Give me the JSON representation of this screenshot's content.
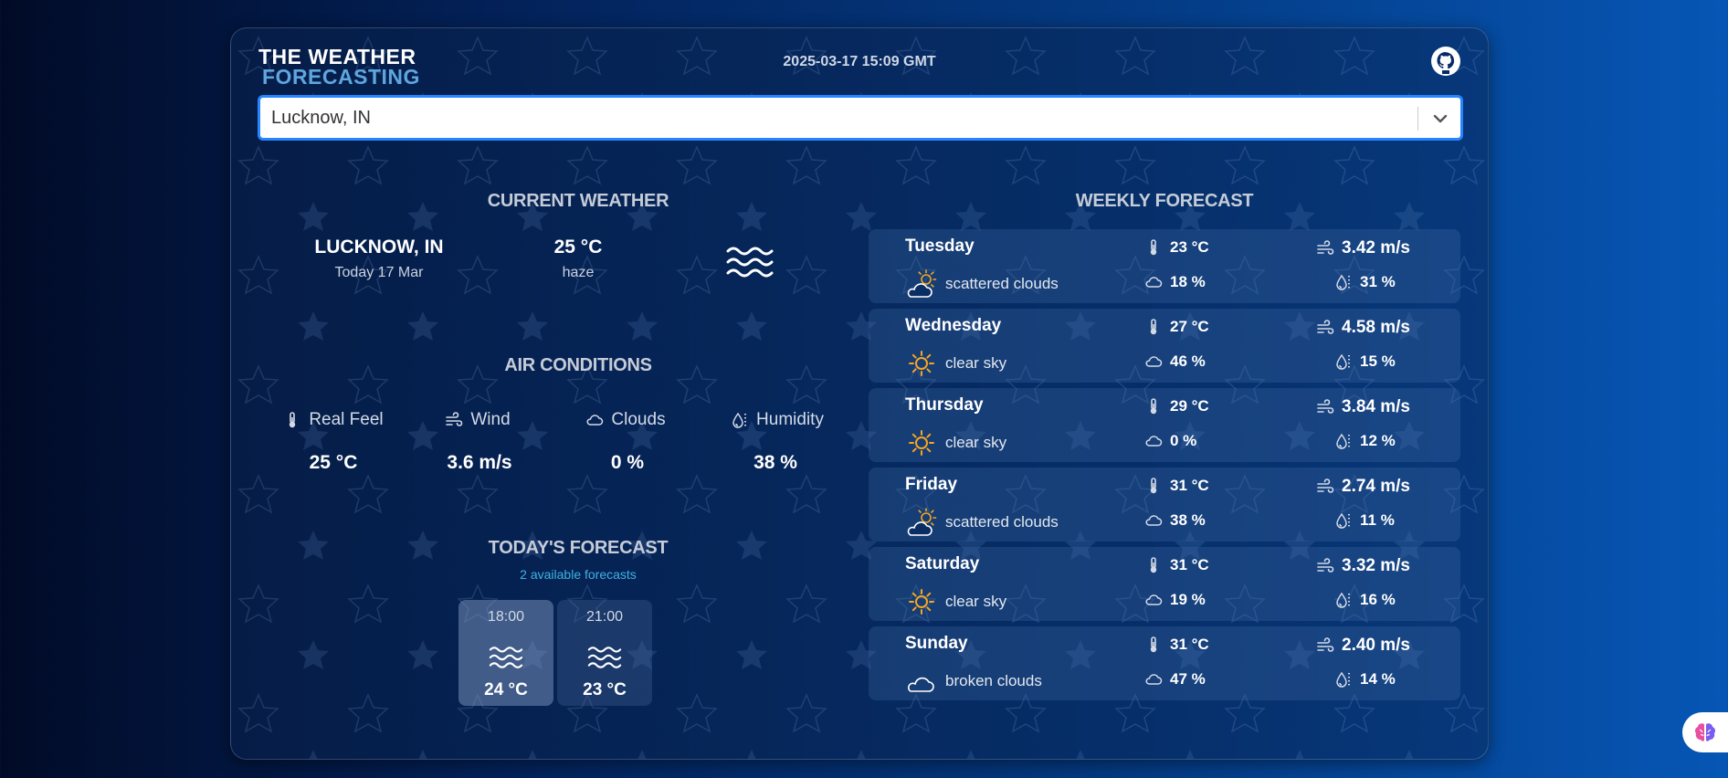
{
  "header": {
    "logo_line1": "THE WEATHER",
    "logo_line2": "FORECASTING",
    "datetime": "2025-03-17 15:09 GMT",
    "github_icon": "github-icon"
  },
  "search": {
    "value": "Lucknow, IN",
    "dropdown_icon": "chevron-down-icon"
  },
  "current_weather": {
    "title": "CURRENT WEATHER",
    "city": "LUCKNOW, IN",
    "date": "Today 17 Mar",
    "temperature": "25 °C",
    "description": "haze",
    "icon": "haze-icon"
  },
  "air_conditions": {
    "title": "AIR CONDITIONS",
    "items": [
      {
        "label": "Real Feel",
        "value": "25 °C",
        "icon": "thermometer-icon"
      },
      {
        "label": "Wind",
        "value": "3.6 m/s",
        "icon": "wind-icon"
      },
      {
        "label": "Clouds",
        "value": "0 %",
        "icon": "cloud-icon"
      },
      {
        "label": "Humidity",
        "value": "38 %",
        "icon": "humidity-icon"
      }
    ]
  },
  "todays_forecast": {
    "title": "TODAY'S FORECAST",
    "subtitle": "2 available forecasts",
    "items": [
      {
        "time": "18:00",
        "temperature": "24 °C",
        "icon": "haze-icon"
      },
      {
        "time": "21:00",
        "temperature": "23 °C",
        "icon": "haze-icon"
      }
    ]
  },
  "weekly_forecast": {
    "title": "WEEKLY FORECAST",
    "days": [
      {
        "day": "Tuesday",
        "condition": "scattered clouds",
        "icon": "partly-cloudy-icon",
        "temperature": "23 °C",
        "wind": "3.42 m/s",
        "clouds": "18 %",
        "humidity": "31 %"
      },
      {
        "day": "Wednesday",
        "condition": "clear sky",
        "icon": "sun-icon",
        "temperature": "27 °C",
        "wind": "4.58 m/s",
        "clouds": "46 %",
        "humidity": "15 %"
      },
      {
        "day": "Thursday",
        "condition": "clear sky",
        "icon": "sun-icon",
        "temperature": "29 °C",
        "wind": "3.84 m/s",
        "clouds": "0 %",
        "humidity": "12 %"
      },
      {
        "day": "Friday",
        "condition": "scattered clouds",
        "icon": "partly-cloudy-icon",
        "temperature": "31 °C",
        "wind": "2.74 m/s",
        "clouds": "38 %",
        "humidity": "11 %"
      },
      {
        "day": "Saturday",
        "condition": "clear sky",
        "icon": "sun-icon",
        "temperature": "31 °C",
        "wind": "3.32 m/s",
        "clouds": "19 %",
        "humidity": "16 %"
      },
      {
        "day": "Sunday",
        "condition": "broken clouds",
        "icon": "cloud-icon",
        "temperature": "31 °C",
        "wind": "2.40 m/s",
        "clouds": "47 %",
        "humidity": "14 %"
      }
    ]
  },
  "colors": {
    "accent": "#2684ff",
    "sun": "#f5a623",
    "subtitle": "#3fb3e6"
  }
}
